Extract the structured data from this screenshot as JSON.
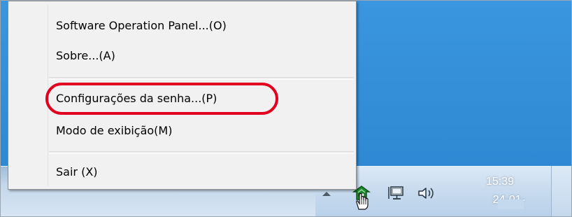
{
  "menu": {
    "items": [
      {
        "label": "Software Operation Panel...(O)"
      },
      {
        "label": "Sobre...(A)"
      },
      {
        "label": "Configurações da senha...(P)"
      },
      {
        "label": "Modo de exibição(M)"
      },
      {
        "label": "Sair (X)"
      }
    ]
  },
  "tray": {
    "icons": [
      "show-hidden-icons-arrow",
      "scanner-icon",
      "network-icon",
      "volume-icon"
    ],
    "clock": {
      "time": "15:39",
      "date": "24-01-"
    }
  },
  "colors": {
    "desktop": "#2f8bd6",
    "taskbar": "#c8dbee",
    "menu_background": "#f1f1f1",
    "highlight": "#e1001f",
    "scanner_icon": "#1f8a2f"
  }
}
